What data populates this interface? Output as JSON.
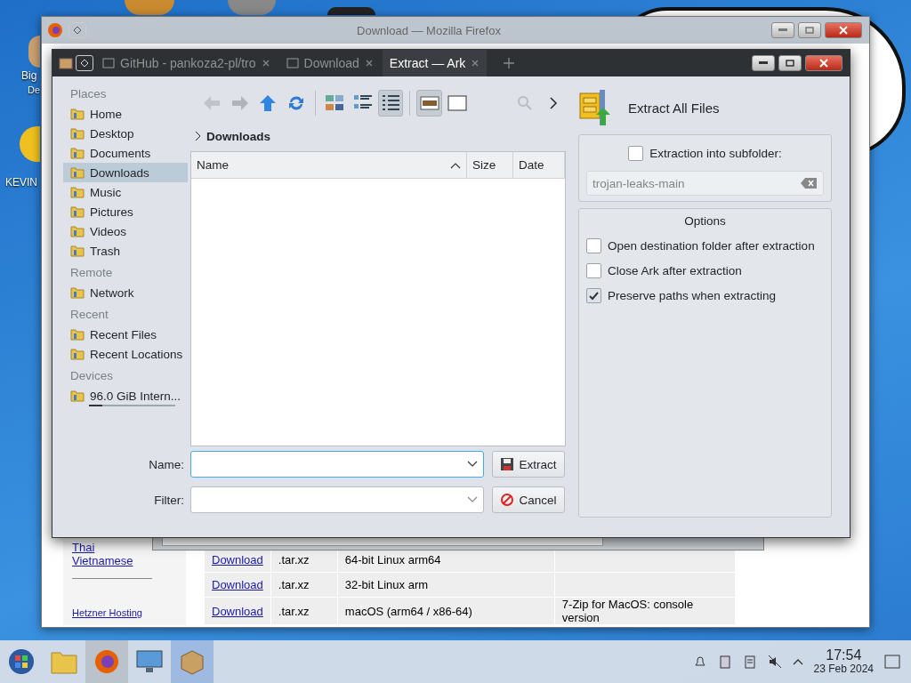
{
  "desktop": {
    "icons": [
      {
        "label": "Big"
      },
      {
        "label": "De"
      },
      {
        "label": "KEVIN"
      }
    ]
  },
  "firefox": {
    "title": "Download — Mozilla Firefox",
    "sidebar_links": [
      "Thai",
      "Vietnamese",
      "Hetzner Hosting"
    ],
    "rows": [
      [
        "Download",
        ".tar.xz",
        "64-bit Linux arm64",
        ""
      ],
      [
        "Download",
        ".tar.xz",
        "32-bit Linux arm",
        ""
      ],
      [
        "Download",
        ".tar.xz",
        "macOS (arm64 / x86-64)",
        "7-Zip for MacOS: console version"
      ]
    ]
  },
  "ark": {
    "tabs": [
      {
        "label": "GitHub - pankoza2-pl/tro",
        "selected": false
      },
      {
        "label": "Download",
        "selected": false
      },
      {
        "label": "Extract — Ark",
        "selected": true
      }
    ],
    "toolbar": {
      "back_disabled": true,
      "forward_disabled": true,
      "view_modes": [
        {
          "selected": false
        },
        {
          "selected": false
        },
        {
          "selected": true
        }
      ],
      "preview_on": true
    },
    "places": [
      {
        "heading": "Places",
        "items": [
          {
            "label": "Home",
            "selected": false
          },
          {
            "label": "Desktop",
            "selected": false
          },
          {
            "label": "Documents",
            "selected": false
          },
          {
            "label": "Downloads",
            "selected": true
          },
          {
            "label": "Music",
            "selected": false
          },
          {
            "label": "Pictures",
            "selected": false
          },
          {
            "label": "Videos",
            "selected": false
          },
          {
            "label": "Trash",
            "selected": false
          }
        ]
      },
      {
        "heading": "Remote",
        "items": [
          {
            "label": "Network",
            "selected": false
          }
        ]
      },
      {
        "heading": "Recent",
        "items": [
          {
            "label": "Recent Files",
            "selected": false
          },
          {
            "label": "Recent Locations",
            "selected": false
          }
        ]
      },
      {
        "heading": "Devices",
        "items": [
          {
            "label": "96.0 GiB Intern...",
            "selected": false,
            "level": 0.15
          }
        ]
      }
    ],
    "breadcrumb": "Downloads",
    "columns": [
      {
        "label": "Name",
        "sorted": true
      },
      {
        "label": "Size",
        "sorted": false
      },
      {
        "label": "Date",
        "sorted": false
      }
    ],
    "name_label": "Name:",
    "filter_label": "Filter:",
    "extract_button": "Extract",
    "cancel_button": "Cancel",
    "panel": {
      "title": "Extract All Files",
      "subfolder": {
        "label": "Extraction into subfolder:",
        "checked": false,
        "placeholder": "trojan-leaks-main"
      },
      "options_title": "Options",
      "options": [
        {
          "label": "Open destination folder after extraction",
          "checked": false
        },
        {
          "label": "Close Ark after extraction",
          "checked": false
        },
        {
          "label": "Preserve paths when extracting",
          "checked": true
        }
      ]
    }
  },
  "taskbar": {
    "apps": [
      {
        "selected": false
      },
      {
        "selected": true
      },
      {
        "selected": false
      },
      {
        "selected": true
      }
    ],
    "time": "17:54",
    "date": "23 Feb 2024"
  }
}
